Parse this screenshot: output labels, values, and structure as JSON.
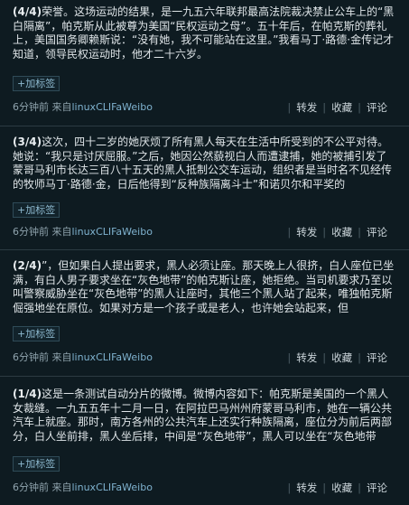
{
  "posts": [
    {
      "part": "(4/4)",
      "text": "荣誉。这场运动的结果，是一九五六年联邦最高法院裁决禁止公车上的“黑白隔离”，帕克斯从此被尊为美国“民权运动之母”。五十年后，在帕克斯的葬礼上，美国国务卿赖斯说：“没有她，我不可能站在这里。”我看马丁·路德·金传记才知道，领导民权运动时，他才二十六岁。",
      "add_tag": "+加标签",
      "time": "6分钟前",
      "source_prefix": "来自",
      "source": "linuxCLIFaWeibo",
      "actions": {
        "forward": "转发",
        "favorite": "收藏",
        "comment": "评论"
      }
    },
    {
      "part": "(3/4)",
      "text": "这次，四十二岁的她厌烦了所有黑人每天在生活中所受到的不公平对待。她说：“我只是讨厌屈服。”之后，她因公然藐视白人而遭逮捕，她的被捕引发了蒙哥马利市长达三百八十五天的黑人抵制公交车运动，组织者是当时名不见经传的牧师马丁·路德·金，日后他得到“反种族隔离斗士”和诺贝尔和平奖的",
      "add_tag": "+加标签",
      "time": "6分钟前",
      "source_prefix": "来自",
      "source": "linuxCLIFaWeibo",
      "actions": {
        "forward": "转发",
        "favorite": "收藏",
        "comment": "评论"
      }
    },
    {
      "part": "(2/4)",
      "text": "”，但如果白人提出要求，黑人必须让座。那天晚上人很挤，白人座位已坐满，有白人男子要求坐在“灰色地带”的帕克斯让座，她拒绝。当司机要求乃至以叫警察威胁坐在“灰色地带”的黑人让座时，其他三个黑人站了起来，唯独帕克斯倔强地坐在原位。如果对方是一个孩子或是老人，也许她会站起来，但",
      "add_tag": "+加标签",
      "time": "6分钟前",
      "source_prefix": "来自",
      "source": "linuxCLIFaWeibo",
      "actions": {
        "forward": "转发",
        "favorite": "收藏",
        "comment": "评论"
      }
    },
    {
      "part": "(1/4)",
      "text": "这是一条测试自动分片的微博。微博内容如下：帕克斯是美国的一个黑人女裁缝。一九五五年十二月一日，在阿拉巴马州州府蒙哥马利市，她在一辆公共汽车上就座。那时，南方各州的公共汽车上还实行种族隔离，座位分为前后两部分，白人坐前排，黑人坐后排，中间是“灰色地带”，黑人可以坐在“灰色地带",
      "add_tag": "+加标签",
      "time": "6分钟前",
      "source_prefix": "来自",
      "source": "linuxCLIFaWeibo",
      "actions": {
        "forward": "转发",
        "favorite": "收藏",
        "comment": "评论"
      }
    }
  ]
}
